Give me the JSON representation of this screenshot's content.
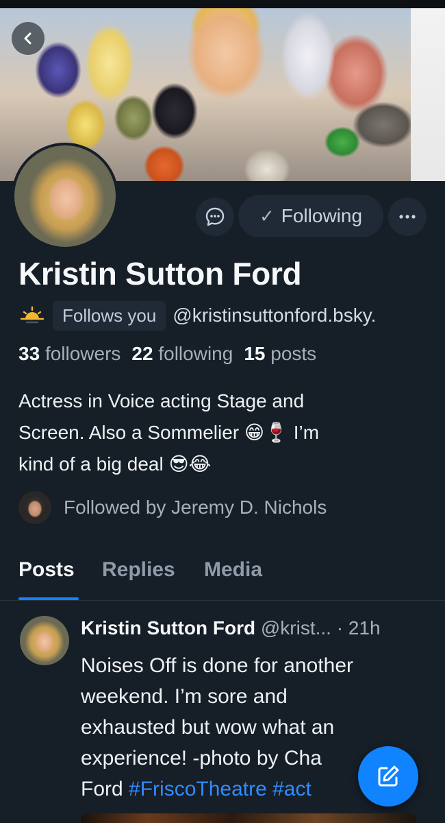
{
  "profile": {
    "display_name": "Kristin Sutton Ford",
    "follows_you_label": "Follows you",
    "handle": "@kristinsuttonford.bsky.",
    "following_button_label": "Following",
    "stats": {
      "followers_count": "33",
      "followers_label": "followers",
      "following_count": "22",
      "following_label": "following",
      "posts_count": "15",
      "posts_label": "posts"
    },
    "bio_line1": "Actress in Voice acting Stage and",
    "bio_line2": "Screen. Also a Sommelier 😁🍷 I’m",
    "bio_line3": "kind of a big deal 😎😂",
    "followed_by": "Followed by Jeremy D. Nichols"
  },
  "tabs": [
    {
      "label": "Posts",
      "active": true
    },
    {
      "label": "Replies",
      "active": false
    },
    {
      "label": "Media",
      "active": false
    }
  ],
  "post": {
    "author": "Kristin Sutton Ford",
    "handle": "@krist...",
    "time": "· 21h",
    "text_line1": "Noises Off is done for another",
    "text_line2": "weekend. I’m sore and",
    "text_line3": "exhausted but wow what an",
    "text_line4": "experience! -photo by Cha",
    "text_line5_prefix": "Ford",
    "hashtag1": "#FriscoTheatre",
    "hashtag2": "#act"
  },
  "colors": {
    "background": "#161e27",
    "accent": "#1083fe",
    "button_bg": "#1f2a36"
  },
  "icons": {
    "back": "chevron-left-icon",
    "message": "message-icon",
    "more": "ellipsis-icon",
    "compose": "compose-icon",
    "sun": "sunrise-icon"
  }
}
